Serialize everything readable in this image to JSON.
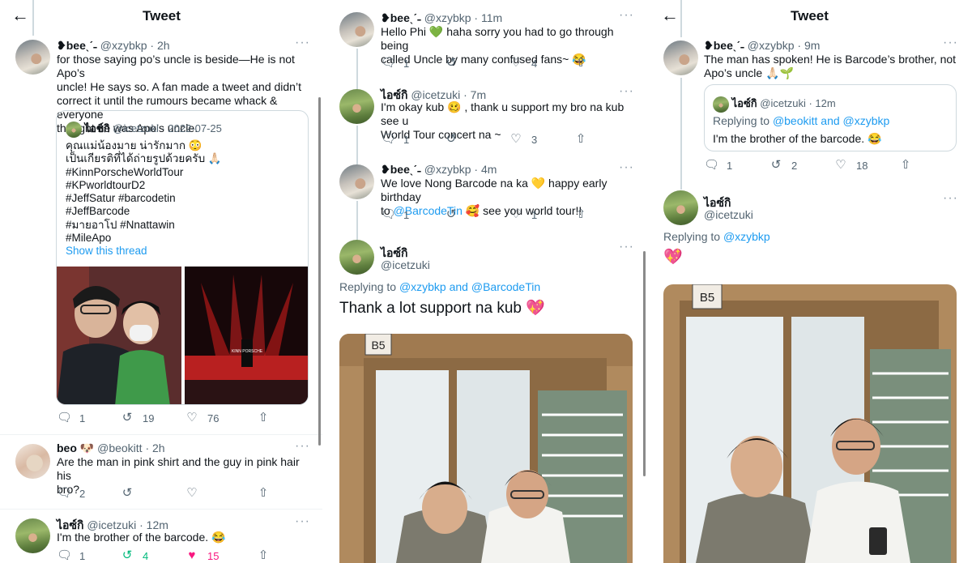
{
  "panel1": {
    "header_title": "Tweet",
    "main_tweet": {
      "name": "❥beeˎˊ˗",
      "handle": "@xzybkp · 2h",
      "lines": [
        "for those saying po’s uncle is beside—He is not Apo’s",
        "uncle! He says so. A fan made a tweet and didn’t",
        "correct it until the rumours became whack & everyone",
        "thought he was Apo’s uncle."
      ],
      "quote": {
        "name": "ไอซ์กิ",
        "handle": "@icetzuki · 2022-07-25",
        "lines": [
          "คุณแม่น้องมาย น่ารักมาก 😳",
          "เป็นเกียรติที่ได้ถ่ายรูปด้วยครับ 🙏🏻",
          "#KinnPorscheWorldTour",
          "#KPworldtourD2",
          "#JeffSatur #barcodetin",
          "#JeffBarcode",
          "#มายอาโป #Nnattawin",
          "#MileApo"
        ],
        "show_thread": "Show this thread",
        "stage_text": "KINN PORSCHE"
      },
      "replies": "1",
      "retweets": "19",
      "likes": "76"
    },
    "reply1": {
      "name": "beo 🐶",
      "handle": "@beokitt · 2h",
      "lines": [
        "Are the man in pink shirt and the guy in pink hair his",
        "bro?"
      ],
      "replies": "2",
      "retweets": "",
      "likes": ""
    },
    "reply2": {
      "name": "ไอซ์กิ",
      "handle": "@icetzuki · 12m",
      "lines": [
        "I'm the brother of the barcode. 😂"
      ],
      "replies": "1",
      "retweets": "4",
      "likes": "15"
    }
  },
  "panel2": {
    "t1": {
      "name": "❥beeˎˊ˗",
      "handle": "@xzybkp · 11m",
      "line1a": "Hello Phi ",
      "line1emoji": "💚",
      "line1b": " haha sorry you had to go through being",
      "line2": "called Uncle by many confused fans~ 😂",
      "replies": "1",
      "retweets": "",
      "likes": "4"
    },
    "t2": {
      "name": "ไอซ์กิ",
      "handle": "@icetzuki · 7m",
      "line1": "I'm okay kub 🥴 , thank u support my bro na kub see u",
      "line2": "World Tour concert na ~",
      "replies": "1",
      "retweets": "",
      "likes": "3"
    },
    "t3": {
      "name": "❥beeˎˊ˗",
      "handle": "@xzybkp · 4m",
      "line1": "We love Nong Barcode na ka 💛 happy early birthday",
      "line2a": "to ",
      "line2link": "@BarcodeTin",
      "line2b": " 🥰 see you world tour!!",
      "replies": "1",
      "retweets": "",
      "likes": "1"
    },
    "main": {
      "name": "ไอซ์กิ",
      "handle": "@icetzuki",
      "replying_prefix": "Replying to ",
      "replying_links": "@xzybkp and @BarcodeTin",
      "text": "Thank a lot support na kub 💖",
      "sign": "B5"
    }
  },
  "panel3": {
    "header_title": "Tweet",
    "t1": {
      "name": "❥beeˎˊ˗",
      "handle": "@xzybkp · 9m",
      "line1": "The man has spoken! He is Barcode’s brother, not",
      "line2": "Apo’s uncle 🙏🏻🌱",
      "quote": {
        "name": "ไอซ์กิ",
        "handle": "@icetzuki · 12m",
        "replying_prefix": "Replying to ",
        "replying_links": "@beokitt and @xzybkp",
        "text": "I'm the brother of the barcode. 😂"
      },
      "replies": "1",
      "retweets": "2",
      "likes": "18"
    },
    "main": {
      "name": "ไอซ์กิ",
      "handle": "@icetzuki",
      "replying_prefix": "Replying to ",
      "replying_link": "@xzybkp",
      "text": "💖",
      "sign": "B5"
    }
  },
  "colors": {
    "link": "#1d9bf0",
    "retweeted": "#00ba7c",
    "liked": "#f91880",
    "muted": "#536471"
  },
  "icons": [
    "back-arrow-icon",
    "reply-icon",
    "retweet-icon",
    "like-icon",
    "share-icon",
    "more-icon"
  ]
}
